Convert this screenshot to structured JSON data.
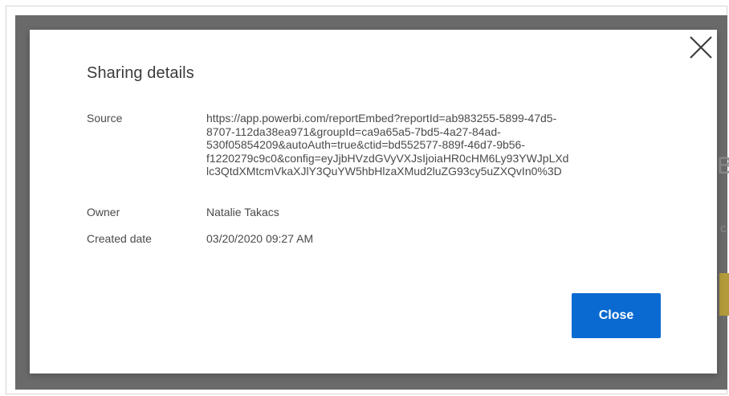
{
  "dialog": {
    "title": "Sharing details",
    "close_label": "Close",
    "rows": {
      "source": {
        "label": "Source",
        "value_lines": [
          "https://app.powerbi.com/reportEmbed?reportId=ab983255-5899-47d5-",
          "8707-112da38ea971&groupId=ca9a65a5-7bd5-4a27-84ad-",
          "530f05854209&autoAuth=true&ctid=bd552577-889f-46d7-9b56-",
          "f1220279c9c0&config=eyJjbHVzdGVyVXJsIjoiaHR0cHM6Ly93YWJpLXd",
          "lc3QtdXMtcmVkaXJlY3QuYW5hbHlzaXMud2luZG93cy5uZXQvIn0%3D"
        ]
      },
      "owner": {
        "label": "Owner",
        "value": "Natalie Takacs"
      },
      "created": {
        "label": "Created date",
        "value": "03/20/2020 09:27 AM"
      }
    },
    "icons": {
      "close": "close-icon"
    }
  },
  "background": {
    "peek_b": "B",
    "peek_c": "c"
  },
  "colors": {
    "accent": "#0a6ad1",
    "overlay": "#6a6a6a"
  }
}
